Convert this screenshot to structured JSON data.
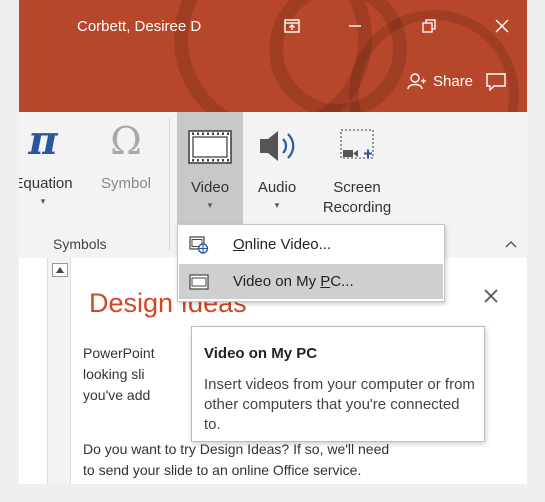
{
  "window": {
    "user": "Corbett, Desiree D"
  },
  "header": {
    "share_label": "Share"
  },
  "ribbon": {
    "equation_label": "Equation",
    "symbol_label": "Symbol",
    "symbols_group_label": "Symbols",
    "video_label": "Video",
    "audio_label": "Audio",
    "screen_recording_label_1": "Screen",
    "screen_recording_label_2": "Recording"
  },
  "video_menu": {
    "items": [
      {
        "label_prefix": "",
        "label_accel": "O",
        "label_rest": "nline Video...",
        "icon": "online-video-icon"
      },
      {
        "label_prefix": "Video on My ",
        "label_accel": "P",
        "label_rest": "C...",
        "icon": "film-icon"
      }
    ]
  },
  "tooltip": {
    "title": "Video on My PC",
    "body": "Insert videos from your computer or from other computers that you're connected to."
  },
  "design_pane": {
    "title": "Design Ideas",
    "para1_line1": "PowerPoint",
    "para1_line2": "looking sli",
    "para1_line3": "you've add",
    "para2_line1": "Do you want to try Design Ideas? If so, we'll need",
    "para2_line2": "to send your slide to an online Office service."
  },
  "colors": {
    "accent": "#b7472a",
    "design_title": "#d24726"
  }
}
